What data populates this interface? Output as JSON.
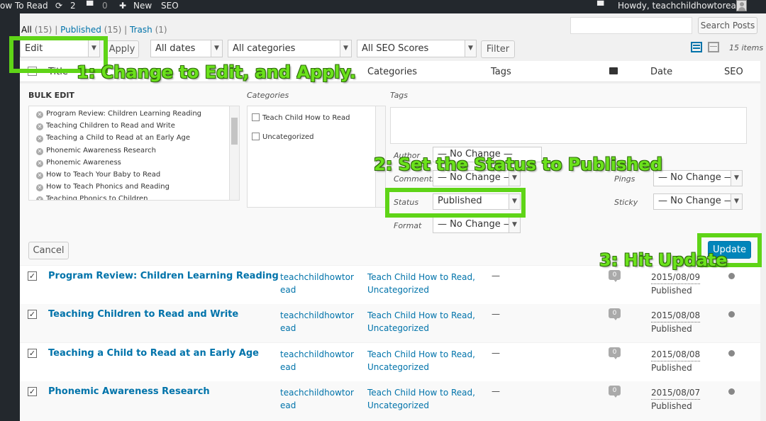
{
  "adminbar": {
    "site_name": "ow To Read",
    "updates_count": "2",
    "comments_count": "0",
    "new_label": "New",
    "seo_label": "SEO",
    "howdy": "Howdy, teachchildhowtoread"
  },
  "filters": {
    "all_label": "All",
    "all_count": "(15)",
    "published_label": "Published",
    "published_count": "(15)",
    "trash_label": "Trash",
    "trash_count": "(1)",
    "sep": "|"
  },
  "search": {
    "button": "Search Posts",
    "value": ""
  },
  "toolbar": {
    "bulk_action": "Edit",
    "apply": "Apply",
    "dates": "All dates",
    "categories": "All categories",
    "seo_scores": "All SEO Scores",
    "filter": "Filter",
    "items_count": "15 items"
  },
  "columns": {
    "title": "Title",
    "categories": "Categories",
    "tags": "Tags",
    "date": "Date",
    "seo": "SEO"
  },
  "bulk_edit": {
    "heading": "BULK EDIT",
    "posts": [
      "Program Review: Children Learning Reading",
      "Teaching Children to Read and Write",
      "Teaching a Child to Read at an Early Age",
      "Phonemic Awareness Research",
      "Phonemic Awareness",
      "How to Teach Your Baby to Read",
      "How to Teach Phonics and Reading",
      "Teaching Phonics to Children"
    ],
    "categories_label": "Categories",
    "categories": [
      "Teach Child How to Read",
      "Uncategorized"
    ],
    "tags_label": "Tags",
    "author_label": "Author",
    "author_value": "— No Change —",
    "comments_label": "Comments",
    "comments_value": "— No Change —",
    "status_label": "Status",
    "status_value": "Published",
    "format_label": "Format",
    "format_value": "— No Change —",
    "pings_label": "Pings",
    "pings_value": "— No Change —",
    "sticky_label": "Sticky",
    "sticky_value": "— No Change —",
    "cancel": "Cancel",
    "update": "Update"
  },
  "rows": [
    {
      "title": "Program Review: Children Learning Reading",
      "author": "teachchildhowtoread",
      "categories": "Teach Child How to Read,",
      "categories2": "Uncategorized",
      "tags": "—",
      "comments": "0",
      "date": "2015/08/09",
      "status": "Published"
    },
    {
      "title": "Teaching Children to Read and Write",
      "author": "teachchildhowtoread",
      "categories": "Teach Child How to Read,",
      "categories2": "Uncategorized",
      "tags": "—",
      "comments": "0",
      "date": "2015/08/08",
      "status": "Published"
    },
    {
      "title": "Teaching a Child to Read at an Early Age",
      "author": "teachchildhowtoread",
      "categories": "Teach Child How to Read,",
      "categories2": "Uncategorized",
      "tags": "—",
      "comments": "0",
      "date": "2015/08/08",
      "status": "Published"
    },
    {
      "title": "Phonemic Awareness Research",
      "author": "teachchildhowtoread",
      "categories": "Teach Child How to Read,",
      "categories2": "Uncategorized",
      "tags": "—",
      "comments": "0",
      "date": "2015/08/07",
      "status": "Published"
    }
  ],
  "annotations": {
    "step1": "1: Change to Edit, and Apply.",
    "step2": "2: Set the Status to Published",
    "step3": "3: Hit Update"
  },
  "colors": {
    "annotation": "#5fd417",
    "link": "#0073aa",
    "primary_button": "#0085ba",
    "admin_bar": "#23282d"
  }
}
